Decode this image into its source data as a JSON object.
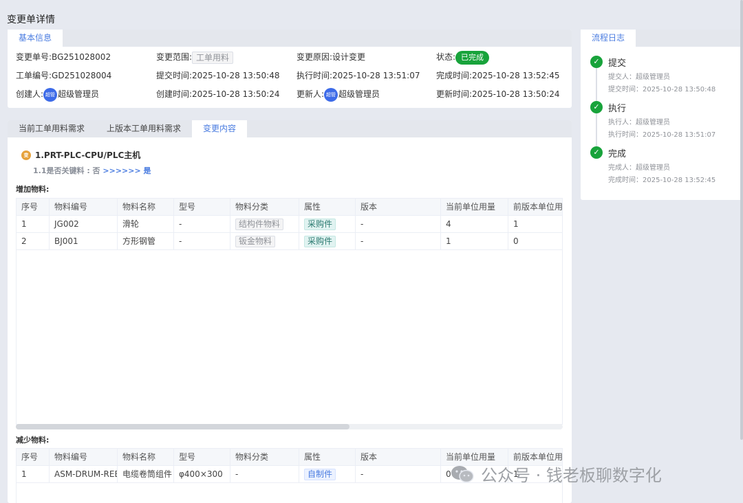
{
  "page": {
    "title": "变更单详情"
  },
  "basic_info": {
    "tab": "基本信息",
    "rows": [
      [
        {
          "label": "变更单号:",
          "value": "BG251028002",
          "kind": "text"
        },
        {
          "label": "变更范围:",
          "value": "工单用料",
          "kind": "tag"
        },
        {
          "label": "变更原因:",
          "value": "设计变更",
          "kind": "text"
        },
        {
          "label": "状态:",
          "value": "已完成",
          "kind": "status"
        }
      ],
      [
        {
          "label": "工单编号:",
          "value": "GD251028004",
          "kind": "text"
        },
        {
          "label": "提交时间:",
          "value": "2025-10-28 13:50:48",
          "kind": "text"
        },
        {
          "label": "执行时间:",
          "value": "2025-10-28 13:51:07",
          "kind": "text"
        },
        {
          "label": "完成时间:",
          "value": "2025-10-28 13:52:45",
          "kind": "text"
        }
      ],
      [
        {
          "label": "创建人:",
          "value": "超级管理员",
          "kind": "user",
          "avatar": "超管"
        },
        {
          "label": "创建时间:",
          "value": "2025-10-28 13:50:24",
          "kind": "text"
        },
        {
          "label": "更新人:",
          "value": "超级管理员",
          "kind": "user",
          "avatar": "超管"
        },
        {
          "label": "更新时间:",
          "value": "2025-10-28 13:50:24",
          "kind": "text"
        }
      ]
    ]
  },
  "change_tabs": [
    "当前工单用料需求",
    "上版本工单用料需求",
    "变更内容"
  ],
  "change_tabs_active": 2,
  "change": {
    "bom_icon": "变",
    "bom_title": "1.PRT-PLC-CPU/PLC主机",
    "key_label": "1.1是否关键料 : 否",
    "key_arrow": ">>>>>> 是",
    "added_label": "增加物料:",
    "removed_label": "减少物料:",
    "columns": [
      "序号",
      "物料编号",
      "物料名称",
      "型号",
      "物料分类",
      "属性",
      "版本",
      "当前单位用量",
      "前版本单位用"
    ],
    "added_rows": [
      [
        "1",
        "JG002",
        "滑轮",
        "-",
        "结构件物料",
        "采购件",
        "-",
        "4",
        "1"
      ],
      [
        "2",
        "BJ001",
        "方形钢管",
        "-",
        "钣金物料",
        "采购件",
        "-",
        "1",
        "0"
      ]
    ],
    "removed_rows": [
      [
        "1",
        "ASM-DRUM-REE",
        "电缆卷筒组件",
        "φ400×300",
        "-",
        "自制件",
        "-",
        "0",
        "1"
      ]
    ]
  },
  "flow": {
    "tab": "流程日志",
    "steps": [
      {
        "name": "提交",
        "meta1": "提交人：超级管理员",
        "meta2": "提交时间：2025-10-28 13:50:48"
      },
      {
        "name": "执行",
        "meta1": "执行人：超级管理员",
        "meta2": "执行时间：2025-10-28 13:51:07"
      },
      {
        "name": "完成",
        "meta1": "完成人：超级管理员",
        "meta2": "完成时间：2025-10-28 13:52:45"
      }
    ]
  },
  "watermark": {
    "text": "公众号 · 钱老板聊数字化",
    "icon": "wechat-icon"
  },
  "colors": {
    "accent": "#4a7ce0",
    "success": "#18a33b",
    "avatar": "#3d6be8"
  }
}
